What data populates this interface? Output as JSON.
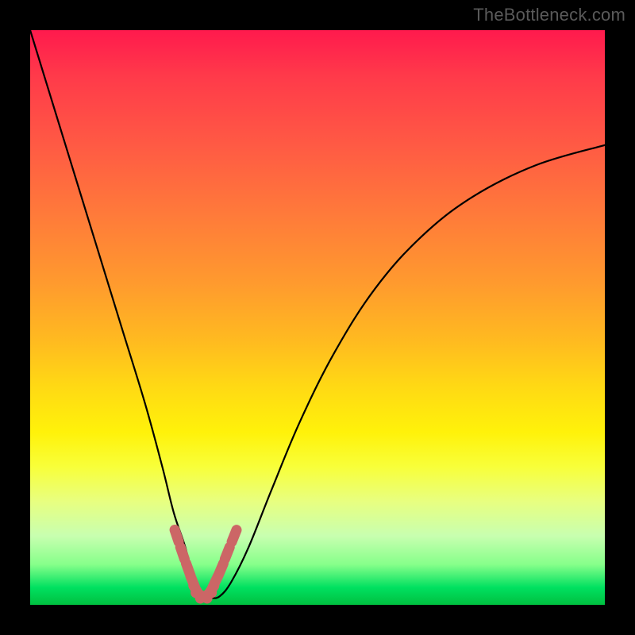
{
  "watermark": "TheBottleneck.com",
  "colors": {
    "frame": "#000000",
    "curve": "#000000",
    "markers": "#cc6666",
    "gradient_stops": [
      "#ff1a4d",
      "#ff7a3a",
      "#ffd914",
      "#e8ff80",
      "#00c040"
    ]
  },
  "chart_data": {
    "type": "line",
    "title": "",
    "xlabel": "",
    "ylabel": "",
    "xlim": [
      0,
      100
    ],
    "ylim": [
      0,
      100
    ],
    "grid": false,
    "legend": false,
    "series": [
      {
        "name": "bottleneck-curve",
        "x": [
          0,
          4,
          8,
          12,
          16,
          20,
          23,
          25,
          27,
          28.5,
          30,
          31.5,
          33,
          35,
          38,
          42,
          47,
          53,
          60,
          68,
          77,
          88,
          100
        ],
        "y": [
          100,
          87,
          74,
          61,
          48,
          35,
          24,
          16,
          10,
          4,
          1.5,
          1.2,
          1.5,
          4,
          10,
          20,
          32,
          44,
          55,
          64,
          71,
          76.5,
          80
        ]
      }
    ],
    "markers": {
      "name": "trough-markers",
      "x": [
        25.5,
        26.5,
        27.5,
        28.3,
        29.0,
        29.8,
        30.6,
        31.4,
        32.2,
        33.2,
        34.3,
        35.5
      ],
      "y": [
        12.0,
        9.0,
        6.2,
        4.0,
        2.4,
        1.6,
        1.6,
        2.4,
        4.0,
        6.2,
        9.0,
        12.0
      ]
    }
  }
}
